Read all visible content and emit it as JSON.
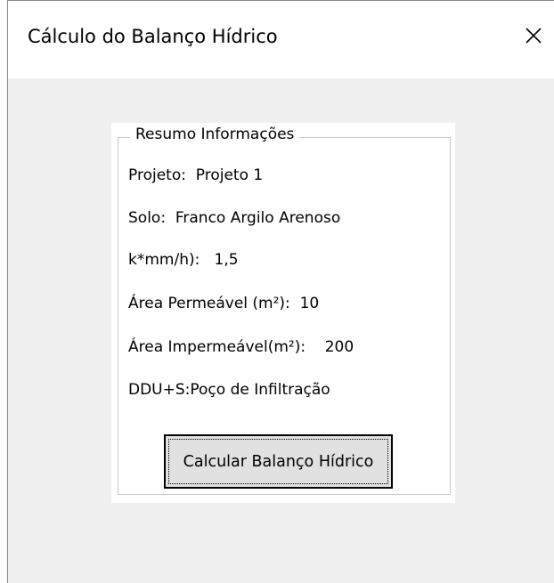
{
  "window": {
    "title": "Cálculo do Balanço Hídrico",
    "close_icon": "close-icon"
  },
  "summary": {
    "legend": "Resumo Informações",
    "lines": [
      "Projeto:  Projeto 1",
      "Solo:  Franco Argilo Arenoso",
      "k*mm/h):   1,5",
      "Área Permeável (m²):  10",
      "Área Impermeável(m²):    200",
      "DDU+S:Poço de Infiltração"
    ]
  },
  "actions": {
    "calculate_label": "Calcular Balanço Hídrico"
  }
}
